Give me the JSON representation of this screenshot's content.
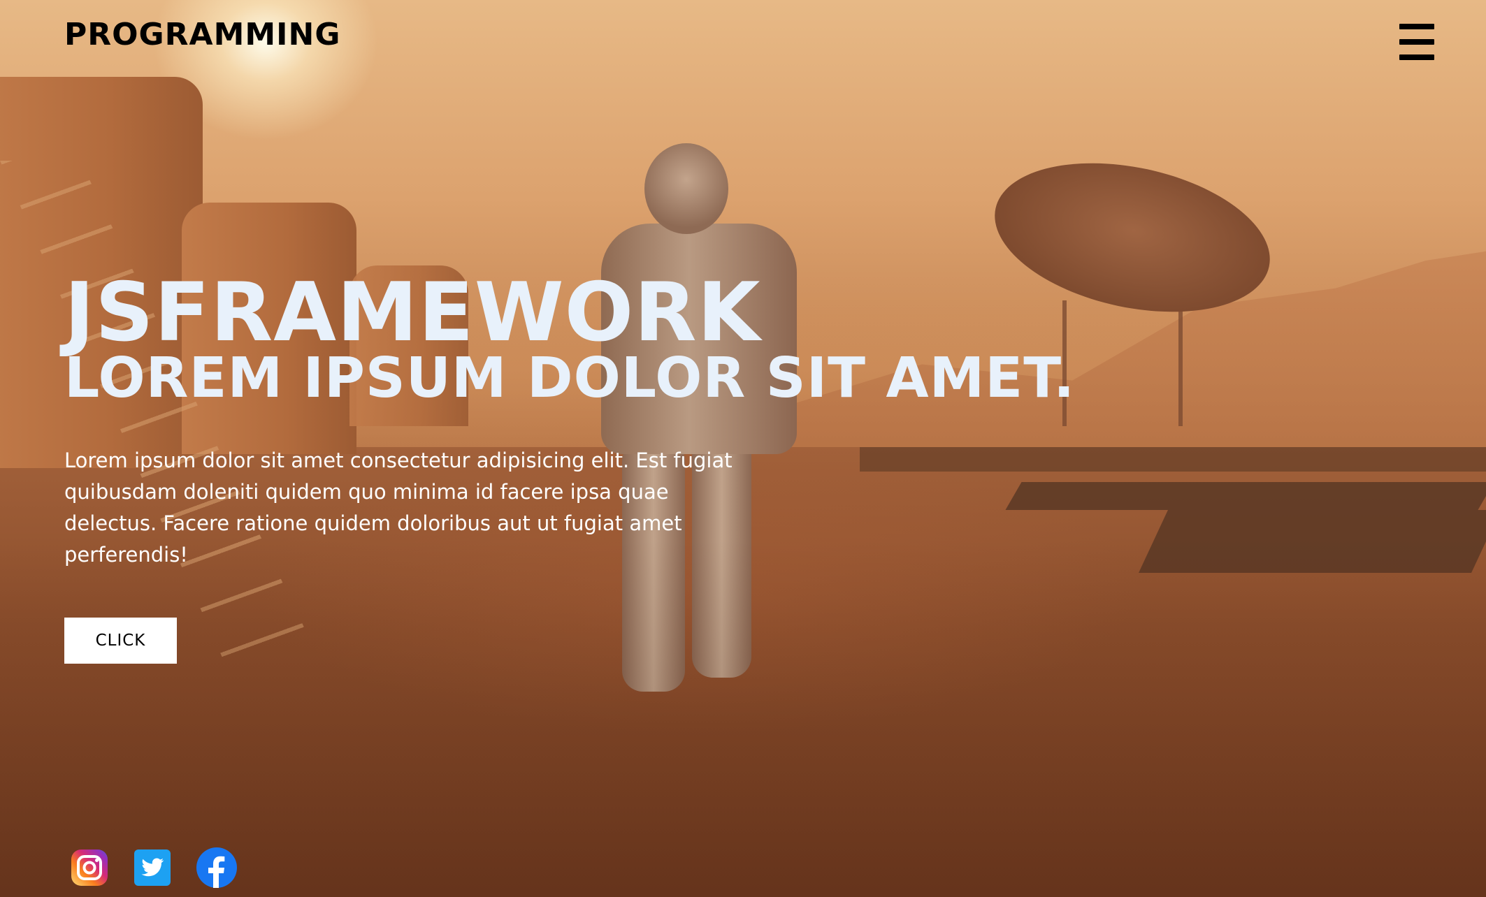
{
  "header": {
    "brand": "PROGRAMMING",
    "menu_icon": "hamburger-menu-icon"
  },
  "hero": {
    "title": "JSFRAMEWORK",
    "subtitle": "LOREM IPSUM DOLOR SIT AMET.",
    "description": "Lorem ipsum dolor sit amet consectetur adipisicing elit. Est fugiat quibusdam doleniti quidem quo minima id facere ipsa quae delectus. Facere ratione quidem doloribus aut ut fugiat amet perferendis!",
    "button_label": "CLICK"
  },
  "social": [
    {
      "name": "instagram-icon",
      "color": "#dd2a7b"
    },
    {
      "name": "twitter-icon",
      "color": "#1da1f2"
    },
    {
      "name": "facebook-icon",
      "color": "#1877f2"
    }
  ],
  "colors": {
    "heading": "#e8f1fb",
    "text": "#ffffff",
    "brand": "#000000",
    "button_bg": "#ffffff"
  }
}
